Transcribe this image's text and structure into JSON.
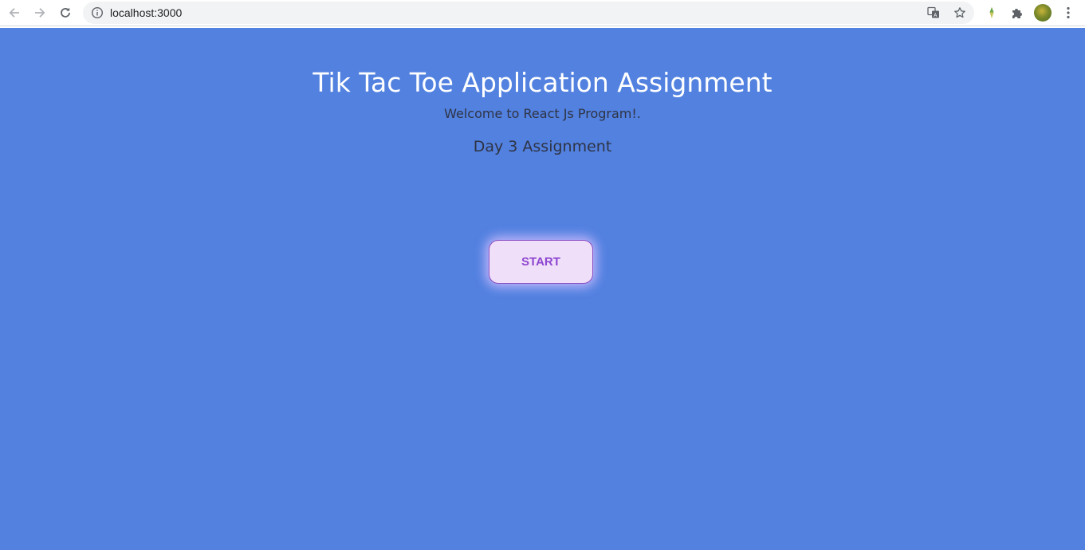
{
  "browser": {
    "url": "localhost:3000",
    "icons": [
      "back-arrow-icon",
      "forward-arrow-icon",
      "reload-icon",
      "info-icon",
      "translate-icon",
      "star-icon",
      "extension-pin-icon",
      "puzzle-icon",
      "profile-avatar",
      "more-menu-icon"
    ]
  },
  "page": {
    "background_color": "#5281e0",
    "title": "Tik Tac Toe Application Assignment",
    "welcome": "Welcome to React Js Program!.",
    "day": "Day 3 Assignment",
    "start_label": "START"
  }
}
